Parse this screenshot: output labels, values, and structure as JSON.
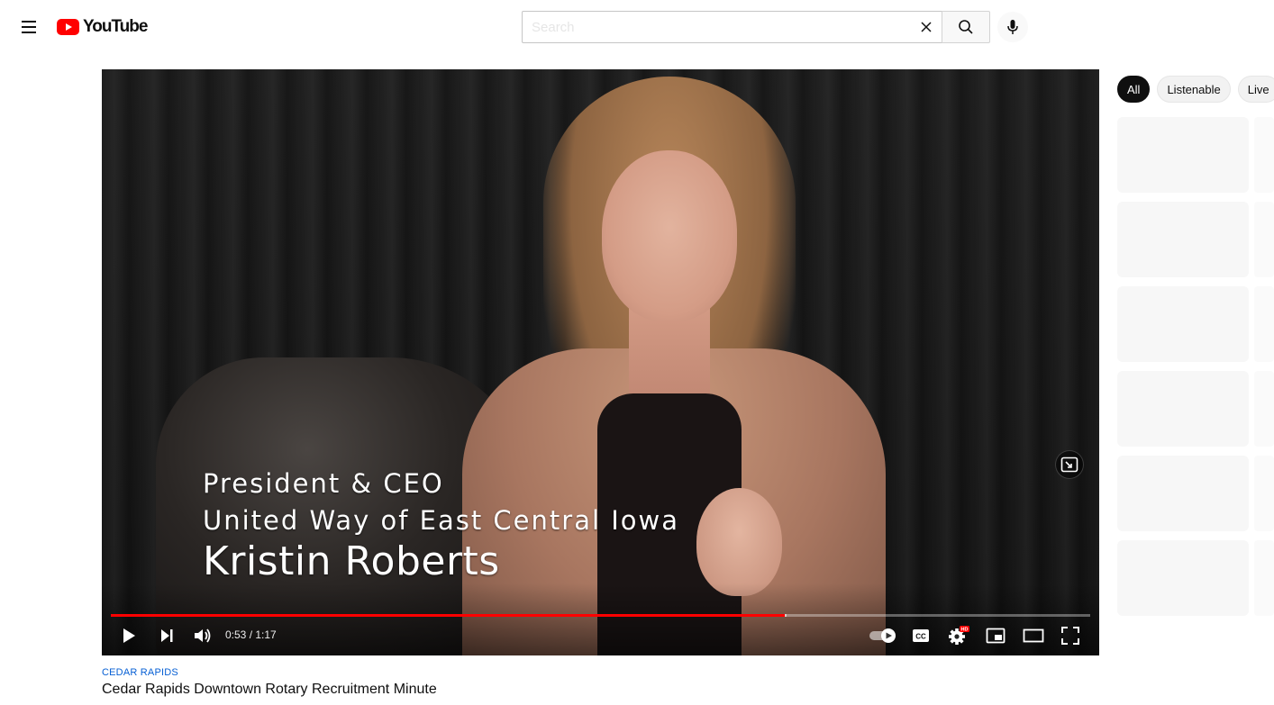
{
  "header": {
    "logo_text": "YouTube",
    "search_placeholder": "Search",
    "search_value": ""
  },
  "player": {
    "lower_third": {
      "line1": "President & CEO",
      "line2": "United Way of East Central Iowa",
      "name": "Kristin Roberts"
    },
    "time_display": "0:53 / 1:17",
    "progress_fraction": 0.6882,
    "buffered_fraction": 0.69,
    "settings_badge": "HD",
    "autoplay_on": true
  },
  "video": {
    "channel_tag": "CEDAR RAPIDS",
    "title": "Cedar Rapids Downtown Rotary Recruitment Minute"
  },
  "sidebar": {
    "chips": [
      {
        "label": "All",
        "active": true
      },
      {
        "label": "Listenable",
        "active": false
      },
      {
        "label": "Live",
        "active": false
      }
    ]
  },
  "colors": {
    "brand_red": "#ff0000",
    "link_blue": "#065fd4",
    "text": "#0f0f0f"
  },
  "icons": {
    "menu": "hamburger-icon",
    "clear": "close-icon",
    "search": "search-icon",
    "mic": "mic-icon",
    "play": "play-icon",
    "next": "skip-next-icon",
    "volume": "volume-icon",
    "autoplay": "autoplay-toggle-icon",
    "captions": "cc-icon",
    "settings": "gear-icon",
    "miniplayer": "miniplayer-icon",
    "theater": "theater-icon",
    "fullscreen": "fullscreen-icon"
  }
}
